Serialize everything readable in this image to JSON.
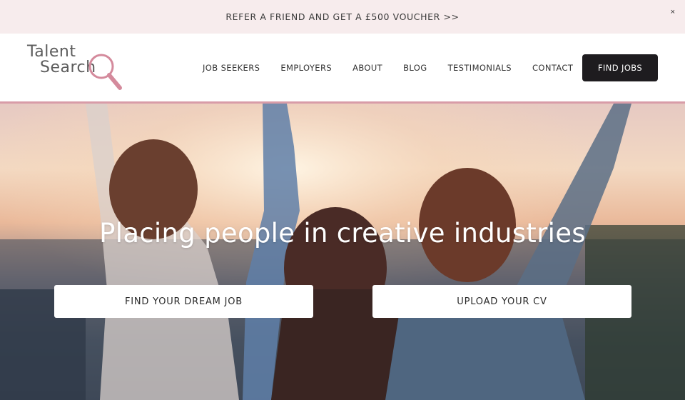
{
  "promo": {
    "text": "REFER A FRIEND AND GET A £500 VOUCHER >>",
    "close": "×"
  },
  "logo": {
    "line1": "Talent",
    "line2": "Search",
    "icon": "magnifying-glass-icon",
    "accent_color": "#d48a9c"
  },
  "nav": {
    "items": [
      "JOB SEEKERS",
      "EMPLOYERS",
      "ABOUT",
      "BLOG",
      "TESTIMONIALS",
      "CONTACT"
    ],
    "cta": "FIND JOBS"
  },
  "hero": {
    "title": "Placing people in creative industries",
    "buttons": {
      "dream_job": "FIND YOUR DREAM JOB",
      "upload_cv": "UPLOAD YOUR CV"
    }
  },
  "colors": {
    "promo_bg": "#f7eced",
    "header_border": "#d89ca8",
    "cta_bg": "#1e1c1f"
  }
}
